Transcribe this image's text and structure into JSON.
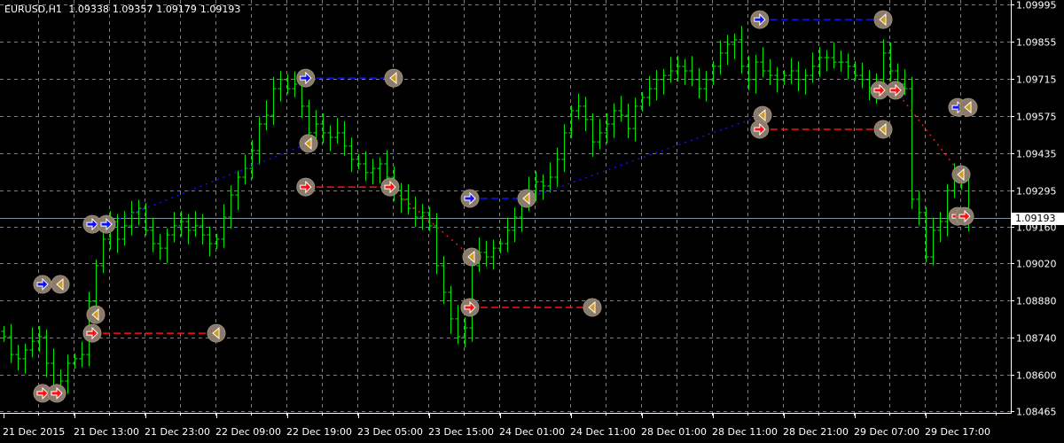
{
  "header": {
    "symbol_timeframe": "EURUSD,H1",
    "open": "1.09338",
    "high": "1.09357",
    "low": "1.09179",
    "close": "1.09193"
  },
  "current_price": "1.09193",
  "colors": {
    "background": "#000000",
    "grid": "#6f7f90",
    "bar": "#00e600",
    "buy": "#1010ff",
    "sell": "#ff1010",
    "close_marker": "#d49a1c",
    "marker_bg": "#8a7b6a",
    "price_line": "#8090a0"
  },
  "chart_data": {
    "type": "ohlc",
    "title": "EURUSD,H1",
    "y_axis_labels": [
      "1.09995",
      "1.09855",
      "1.09715",
      "1.09575",
      "1.09435",
      "1.09295",
      "1.09160",
      "1.09020",
      "1.08880",
      "1.08740",
      "1.08600",
      "1.08465"
    ],
    "ylim": [
      1.08465,
      1.09995
    ],
    "x_axis_labels": [
      "21 Dec 2015",
      "21 Dec 13:00",
      "21 Dec 23:00",
      "22 Dec 09:00",
      "22 Dec 19:00",
      "23 Dec 05:00",
      "23 Dec 15:00",
      "24 Dec 01:00",
      "24 Dec 11:00",
      "28 Dec 01:00",
      "28 Dec 11:00",
      "28 Dec 21:00",
      "29 Dec 07:00",
      "29 Dec 17:00"
    ],
    "bars_per_label": 10,
    "grid": true,
    "default_wick": 0.0004,
    "closes": [
      1.08745,
      1.08678,
      1.08662,
      1.08695,
      1.08728,
      1.08745,
      1.08645,
      1.08545,
      1.08578,
      1.08645,
      1.08662,
      1.08678,
      1.08878,
      1.09012,
      1.09112,
      1.09178,
      1.09112,
      1.09162,
      1.09212,
      1.09228,
      1.09145,
      1.09095,
      1.09078,
      1.09128,
      1.09162,
      1.09178,
      1.09145,
      1.09162,
      1.09128,
      1.09095,
      1.09112,
      1.09195,
      1.09278,
      1.09345,
      1.09378,
      1.09445,
      1.09545,
      1.09578,
      1.09678,
      1.09712,
      1.09678,
      1.09695,
      1.09612,
      1.09512,
      1.09545,
      1.09512,
      1.09495,
      1.09512,
      1.09462,
      1.09412,
      1.09395,
      1.09362,
      1.09378,
      1.09395,
      1.09345,
      1.09295,
      1.09262,
      1.09228,
      1.09195,
      1.09212,
      1.09162,
      1.09012,
      1.08912,
      1.08812,
      1.08745,
      1.08778,
      1.09012,
      1.09062,
      1.09045,
      1.09078,
      1.09095,
      1.09145,
      1.09195,
      1.09245,
      1.09295,
      1.09328,
      1.09312,
      1.09345,
      1.09412,
      1.09512,
      1.09595,
      1.09612,
      1.09562,
      1.09478,
      1.09512,
      1.09545,
      1.09595,
      1.09578,
      1.09528,
      1.09612,
      1.09645,
      1.09678,
      1.09712,
      1.09728,
      1.09745,
      1.09762,
      1.09745,
      1.09712,
      1.09678,
      1.09712,
      1.09762,
      1.09812,
      1.09845,
      1.09862,
      1.09762,
      1.09712,
      1.09778,
      1.09745,
      1.09728,
      1.09712,
      1.09728,
      1.09745,
      1.09712,
      1.09728,
      1.09762,
      1.09795,
      1.09795,
      1.09778,
      1.09778,
      1.09762,
      1.09728,
      1.09712,
      1.09678,
      1.09712,
      1.09812,
      1.09745,
      1.09695,
      1.09678,
      1.09262,
      1.09212,
      1.09045,
      1.09145,
      1.09178,
      1.09295,
      1.09345,
      1.09338,
      1.09193
    ],
    "markers": [
      {
        "bar": 5.5,
        "price": 1.08942,
        "kind": "buy"
      },
      {
        "bar": 8,
        "price": 1.08942,
        "kind": "close"
      },
      {
        "bar": 5.5,
        "price": 1.08532,
        "kind": "sell"
      },
      {
        "bar": 7.5,
        "price": 1.08532,
        "kind": "sell"
      },
      {
        "bar": 12.5,
        "price": 1.08758,
        "kind": "sell"
      },
      {
        "bar": 30,
        "price": 1.08758,
        "kind": "close"
      },
      {
        "bar": 13,
        "price": 1.08828,
        "kind": "close"
      },
      {
        "bar": 12.5,
        "price": 1.09168,
        "kind": "buy"
      },
      {
        "bar": 14.5,
        "price": 1.09168,
        "kind": "buy"
      },
      {
        "bar": 42.6,
        "price": 1.09718,
        "kind": "buy"
      },
      {
        "bar": 55,
        "price": 1.09718,
        "kind": "close"
      },
      {
        "bar": 43,
        "price": 1.09472,
        "kind": "close"
      },
      {
        "bar": 42.6,
        "price": 1.09308,
        "kind": "sell"
      },
      {
        "bar": 54.5,
        "price": 1.09308,
        "kind": "sell"
      },
      {
        "bar": 66,
        "price": 1.09045,
        "kind": "close"
      },
      {
        "bar": 65.75,
        "price": 1.09265,
        "kind": "buy"
      },
      {
        "bar": 73.75,
        "price": 1.09265,
        "kind": "close"
      },
      {
        "bar": 65.75,
        "price": 1.08855,
        "kind": "sell"
      },
      {
        "bar": 83,
        "price": 1.08855,
        "kind": "close"
      },
      {
        "bar": 106.6,
        "price": 1.09938,
        "kind": "buy"
      },
      {
        "bar": 124,
        "price": 1.09938,
        "kind": "close"
      },
      {
        "bar": 107,
        "price": 1.09578,
        "kind": "close"
      },
      {
        "bar": 106.6,
        "price": 1.09525,
        "kind": "sell"
      },
      {
        "bar": 124,
        "price": 1.09525,
        "kind": "close"
      },
      {
        "bar": 123.5,
        "price": 1.09672,
        "kind": "sell"
      },
      {
        "bar": 125.75,
        "price": 1.09672,
        "kind": "sell"
      },
      {
        "bar": 135,
        "price": 1.09355,
        "kind": "close"
      },
      {
        "bar": 134.5,
        "price": 1.09608,
        "kind": "buy"
      },
      {
        "bar": 136,
        "price": 1.09608,
        "kind": "close"
      },
      {
        "bar": 134.5,
        "price": 1.09198,
        "kind": "sell"
      },
      {
        "bar": 135.5,
        "price": 1.09198,
        "kind": "sell"
      }
    ],
    "trade_lines": [
      {
        "from": [
          5.5,
          1.08942
        ],
        "to": [
          8,
          1.08942
        ],
        "side": "buy",
        "style": "dash"
      },
      {
        "from": [
          12.5,
          1.08758
        ],
        "to": [
          30,
          1.08758
        ],
        "side": "sell",
        "style": "dash"
      },
      {
        "from": [
          15.5,
          1.0918
        ],
        "to": [
          43,
          1.09472
        ],
        "side": "buy",
        "style": "dot"
      },
      {
        "from": [
          42.6,
          1.09718
        ],
        "to": [
          55,
          1.09718
        ],
        "side": "buy",
        "style": "dash"
      },
      {
        "from": [
          42.6,
          1.09308
        ],
        "to": [
          54.5,
          1.09308
        ],
        "side": "sell",
        "style": "dash"
      },
      {
        "from": [
          54.5,
          1.09308
        ],
        "to": [
          66,
          1.09045
        ],
        "side": "sell",
        "style": "dot"
      },
      {
        "from": [
          65.75,
          1.09265
        ],
        "to": [
          73.75,
          1.09265
        ],
        "side": "buy",
        "style": "dash"
      },
      {
        "from": [
          73.75,
          1.09265
        ],
        "to": [
          107,
          1.09578
        ],
        "side": "buy",
        "style": "dot"
      },
      {
        "from": [
          65.75,
          1.08855
        ],
        "to": [
          83,
          1.08855
        ],
        "side": "sell",
        "style": "dash"
      },
      {
        "from": [
          106.6,
          1.09938
        ],
        "to": [
          124,
          1.09938
        ],
        "side": "buy",
        "style": "dash"
      },
      {
        "from": [
          106.6,
          1.09525
        ],
        "to": [
          124,
          1.09525
        ],
        "side": "sell",
        "style": "dash"
      },
      {
        "from": [
          125.75,
          1.09672
        ],
        "to": [
          135,
          1.09355
        ],
        "side": "sell",
        "style": "dot"
      },
      {
        "from": [
          134.5,
          1.09608
        ],
        "to": [
          136,
          1.09608
        ],
        "side": "buy",
        "style": "dash"
      }
    ]
  }
}
